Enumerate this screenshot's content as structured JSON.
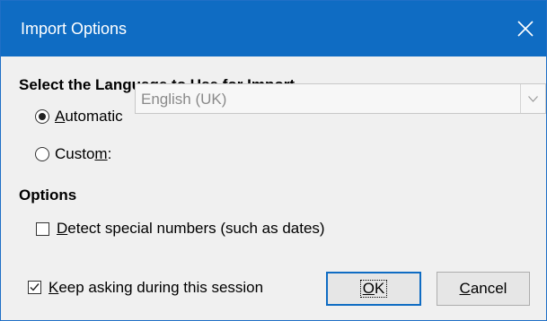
{
  "window": {
    "title": "Import Options",
    "accent_color": "#0f6cc3",
    "close_icon": "close-icon"
  },
  "language_section": {
    "heading": "Select the Language to Use for Import",
    "automatic": {
      "prefix": "",
      "mnemonic": "A",
      "rest": "utomatic",
      "checked": true
    },
    "custom": {
      "prefix": "Custo",
      "mnemonic": "m",
      "rest": ":",
      "checked": false
    },
    "custom_select": {
      "value": "English (UK)",
      "enabled": false
    }
  },
  "options_section": {
    "heading": "Options",
    "detect_numbers": {
      "mnemonic": "D",
      "rest": "etect special numbers (such as dates)",
      "checked": false
    }
  },
  "footer": {
    "keep_asking": {
      "mnemonic": "K",
      "rest": "eep asking during this session",
      "checked": true
    },
    "ok_button": {
      "mnemonic": "O",
      "rest": "K"
    },
    "cancel_button": {
      "mnemonic": "C",
      "rest": "ancel"
    }
  }
}
